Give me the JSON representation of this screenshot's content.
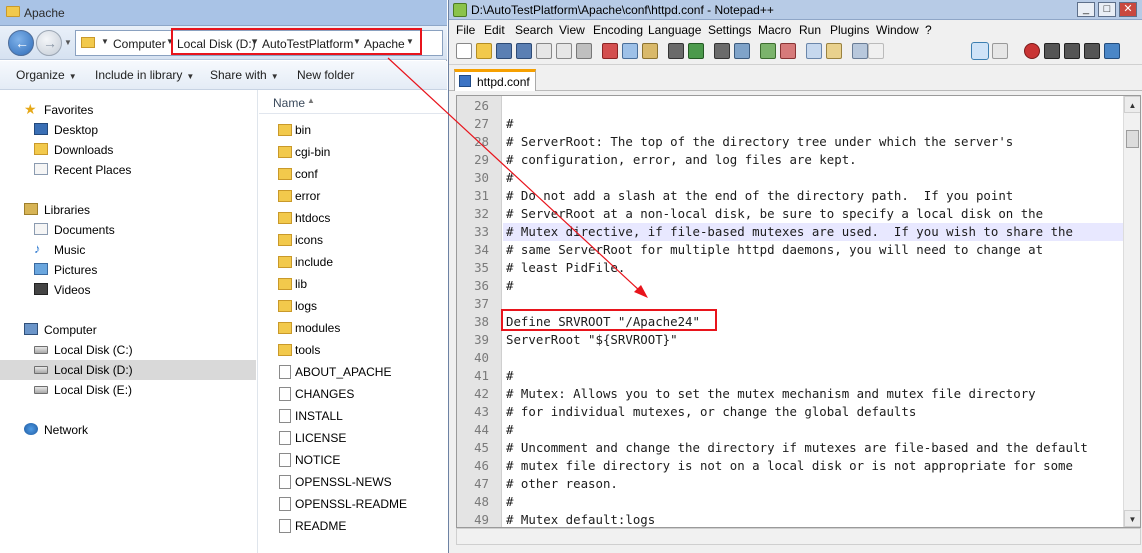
{
  "explorer": {
    "title": "Apache",
    "breadcrumb": [
      "Computer",
      "Local Disk (D:)",
      "AutoTestPlatform",
      "Apache"
    ],
    "toolbar": {
      "organize": "Organize",
      "include_in_library": "Include in library",
      "share_with": "Share with",
      "new_folder": "New folder"
    },
    "nav": {
      "favorites": "Favorites",
      "desktop": "Desktop",
      "downloads": "Downloads",
      "recent_places": "Recent Places",
      "libraries": "Libraries",
      "documents": "Documents",
      "music": "Music",
      "pictures": "Pictures",
      "videos": "Videos",
      "computer": "Computer",
      "disk_c": "Local Disk (C:)",
      "disk_d": "Local Disk (D:)",
      "disk_e": "Local Disk (E:)",
      "network": "Network"
    },
    "column_name": "Name",
    "files": [
      {
        "name": "bin",
        "type": "folder"
      },
      {
        "name": "cgi-bin",
        "type": "folder"
      },
      {
        "name": "conf",
        "type": "folder"
      },
      {
        "name": "error",
        "type": "folder"
      },
      {
        "name": "htdocs",
        "type": "folder"
      },
      {
        "name": "icons",
        "type": "folder"
      },
      {
        "name": "include",
        "type": "folder"
      },
      {
        "name": "lib",
        "type": "folder"
      },
      {
        "name": "logs",
        "type": "folder"
      },
      {
        "name": "modules",
        "type": "folder"
      },
      {
        "name": "tools",
        "type": "folder"
      },
      {
        "name": "ABOUT_APACHE",
        "type": "file"
      },
      {
        "name": "CHANGES",
        "type": "file"
      },
      {
        "name": "INSTALL",
        "type": "file"
      },
      {
        "name": "LICENSE",
        "type": "file"
      },
      {
        "name": "NOTICE",
        "type": "file"
      },
      {
        "name": "OPENSSL-NEWS",
        "type": "file"
      },
      {
        "name": "OPENSSL-README",
        "type": "file"
      },
      {
        "name": "README",
        "type": "file"
      }
    ]
  },
  "notepad": {
    "title": "D:\\AutoTestPlatform\\Apache\\conf\\httpd.conf - Notepad++",
    "window_buttons": {
      "minimize": "_",
      "maximize": "□",
      "close": "✕"
    },
    "menu": [
      "File",
      "Edit",
      "Search",
      "View",
      "Encoding",
      "Language",
      "Settings",
      "Macro",
      "Run",
      "Plugins",
      "Window",
      "?"
    ],
    "tab": "httpd.conf",
    "lines": [
      {
        "n": "26",
        "t": ""
      },
      {
        "n": "27",
        "t": "#"
      },
      {
        "n": "28",
        "t": "# ServerRoot: The top of the directory tree under which the server's"
      },
      {
        "n": "29",
        "t": "# configuration, error, and log files are kept."
      },
      {
        "n": "30",
        "t": "#"
      },
      {
        "n": "31",
        "t": "# Do not add a slash at the end of the directory path.  If you point"
      },
      {
        "n": "32",
        "t": "# ServerRoot at a non-local disk, be sure to specify a local disk on the"
      },
      {
        "n": "33",
        "t": "# Mutex directive, if file-based mutexes are used.  If you wish to share the"
      },
      {
        "n": "34",
        "t": "# same ServerRoot for multiple httpd daemons, you will need to change at"
      },
      {
        "n": "35",
        "t": "# least PidFile."
      },
      {
        "n": "36",
        "t": "#"
      },
      {
        "n": "37",
        "t": ""
      },
      {
        "n": "38",
        "t": "Define SRVROOT \"/Apache24\""
      },
      {
        "n": "39",
        "t": "ServerRoot \"${SRVROOT}\""
      },
      {
        "n": "40",
        "t": ""
      },
      {
        "n": "41",
        "t": "#"
      },
      {
        "n": "42",
        "t": "# Mutex: Allows you to set the mutex mechanism and mutex file directory"
      },
      {
        "n": "43",
        "t": "# for individual mutexes, or change the global defaults"
      },
      {
        "n": "44",
        "t": "#"
      },
      {
        "n": "45",
        "t": "# Uncomment and change the directory if mutexes are file-based and the default"
      },
      {
        "n": "46",
        "t": "# mutex file directory is not on a local disk or is not appropriate for some"
      },
      {
        "n": "47",
        "t": "# other reason."
      },
      {
        "n": "48",
        "t": "#"
      },
      {
        "n": "49",
        "t": "# Mutex default:logs"
      }
    ]
  },
  "colors": {
    "annotation_red": "#e8141c",
    "highlight_line": "#e8e8ff",
    "nav_selected": "#d9d9d9"
  }
}
